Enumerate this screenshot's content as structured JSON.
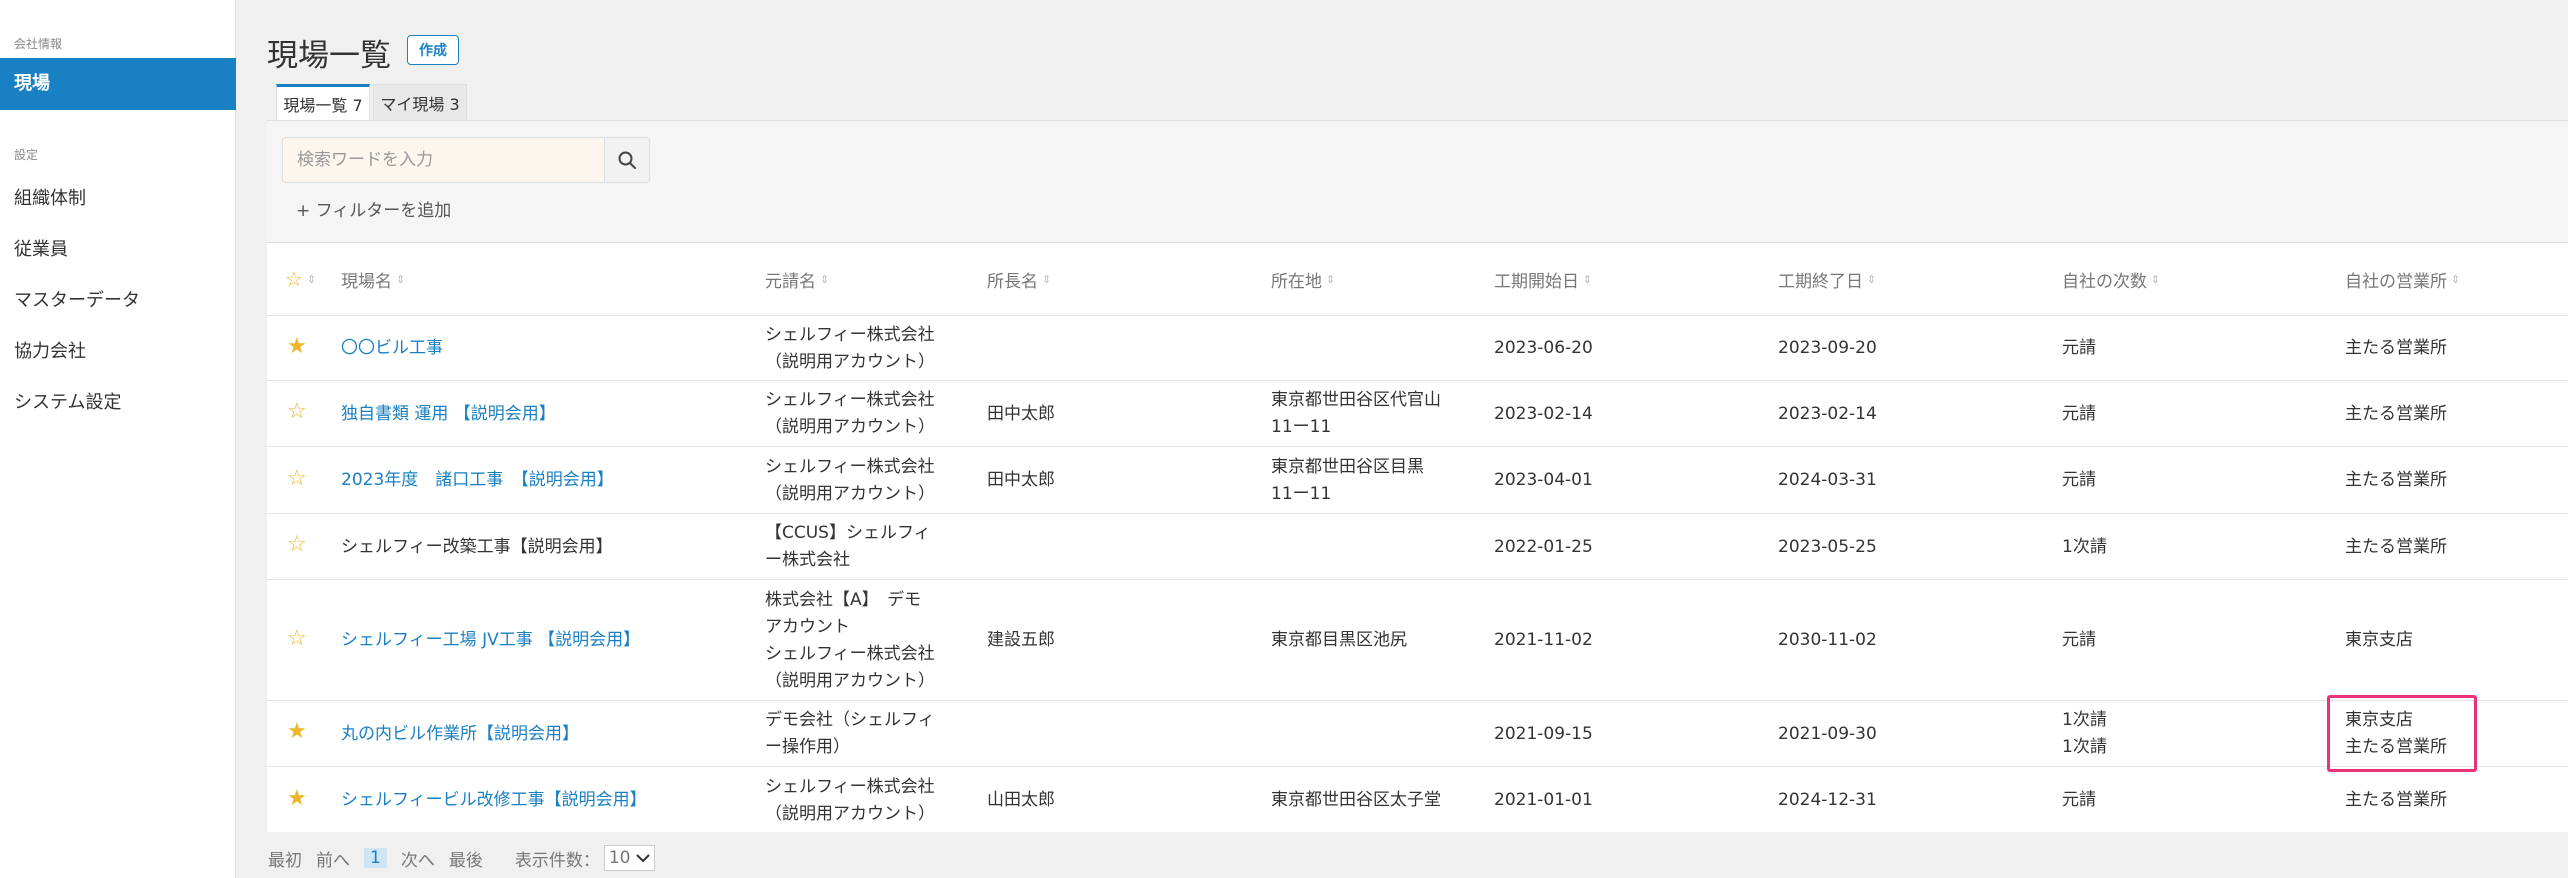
{
  "sidebar": {
    "section_company": "会社情報",
    "active_item": "現場",
    "section_settings": "設定",
    "items": [
      "組織体制",
      "従業員",
      "マスターデータ",
      "協力会社",
      "システム設定"
    ]
  },
  "header": {
    "title": "現場一覧",
    "create_label": "作成"
  },
  "tabs": [
    {
      "label": "現場一覧 7"
    },
    {
      "label": "マイ現場 3"
    }
  ],
  "search": {
    "placeholder": "検索ワードを入力",
    "add_filter": "+ フィルターを追加"
  },
  "table": {
    "columns": [
      "現場名",
      "元請名",
      "所長名",
      "所在地",
      "工期開始日",
      "工期終了日",
      "自社の次数",
      "自社の営業所"
    ],
    "rows": [
      {
        "starred": true,
        "name": "〇〇ビル工事",
        "name_link": true,
        "prime": [
          "シェルフィー株式会社",
          "（説明用アカウント）"
        ],
        "manager": "",
        "location": [],
        "start": "2023-06-20",
        "end": "2023-09-20",
        "tier": [
          "元請"
        ],
        "office": [
          "主たる営業所"
        ]
      },
      {
        "starred": false,
        "name": "独自書類 運用 【説明会用】",
        "name_link": true,
        "prime": [
          "シェルフィー株式会社",
          "（説明用アカウント）"
        ],
        "manager": "田中太郎",
        "location": [
          "東京都世田谷区代官山",
          "11ー11"
        ],
        "start": "2023-02-14",
        "end": "2023-02-14",
        "tier": [
          "元請"
        ],
        "office": [
          "主たる営業所"
        ]
      },
      {
        "starred": false,
        "name": "2023年度　諸口工事　【説明会用】",
        "name_link": true,
        "prime": [
          "シェルフィー株式会社",
          "（説明用アカウント）"
        ],
        "manager": "田中太郎",
        "location": [
          "東京都世田谷区目黒",
          "11ー11"
        ],
        "start": "2023-04-01",
        "end": "2024-03-31",
        "tier": [
          "元請"
        ],
        "office": [
          "主たる営業所"
        ]
      },
      {
        "starred": false,
        "name": "シェルフィー改築工事【説明会用】",
        "name_link": false,
        "prime": [
          "【CCUS】シェルフィ",
          "ー株式会社"
        ],
        "manager": "",
        "location": [],
        "start": "2022-01-25",
        "end": "2023-05-25",
        "tier": [
          "1次請"
        ],
        "office": [
          "主たる営業所"
        ]
      },
      {
        "starred": false,
        "name": "シェルフィー工場 JV工事 【説明会用】",
        "name_link": true,
        "prime": [
          "株式会社【A】　デモ",
          "アカウント",
          "シェルフィー株式会社",
          "（説明用アカウント）"
        ],
        "manager": "建設五郎",
        "location": [
          "東京都目黒区池尻"
        ],
        "start": "2021-11-02",
        "end": "2030-11-02",
        "tier": [
          "元請"
        ],
        "office": [
          "東京支店"
        ]
      },
      {
        "starred": true,
        "name": "丸の内ビル作業所【説明会用】",
        "name_link": true,
        "prime": [
          "デモ会社（シェルフィ",
          "ー操作用）"
        ],
        "manager": "",
        "location": [],
        "start": "2021-09-15",
        "end": "2021-09-30",
        "tier": [
          "1次請",
          "1次請"
        ],
        "office": [
          "東京支店",
          "主たる営業所"
        ]
      },
      {
        "starred": true,
        "name": "シェルフィービル改修工事【説明会用】",
        "name_link": true,
        "prime": [
          "シェルフィー株式会社",
          "（説明用アカウント）"
        ],
        "manager": "山田太郎",
        "location": [
          "東京都世田谷区太子堂"
        ],
        "start": "2021-01-01",
        "end": "2024-12-31",
        "tier": [
          "元請"
        ],
        "office": [
          "主たる営業所"
        ]
      }
    ]
  },
  "pager": {
    "first": "最初",
    "prev": "前へ",
    "current": "1",
    "next": "次へ",
    "last": "最後",
    "per_page_label": "表示件数：",
    "per_page_value": "10"
  }
}
